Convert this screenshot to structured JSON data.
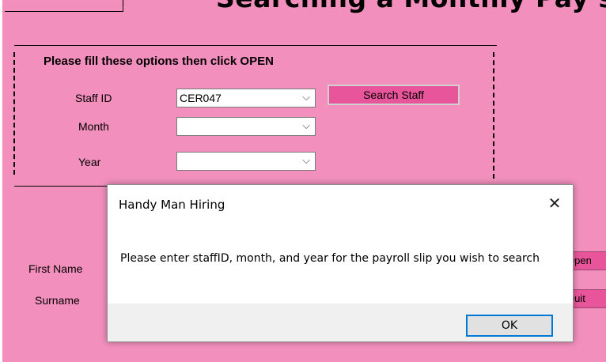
{
  "form": {
    "title": "Searching a Monthly Pay slip",
    "group_title": "Please fill these options then click OPEN",
    "staff_id_label": "Staff ID",
    "staff_id_value": "CER047",
    "month_label": "Month",
    "month_value": "",
    "year_label": "Year",
    "year_value": "",
    "search_staff_label": "Search Staff",
    "first_name_label": "First Name",
    "surname_label": "Surname",
    "open_label": "Open",
    "quit_label": "Quit"
  },
  "dialog": {
    "title": "Handy Man Hiring",
    "message": "Please enter staffID, month, and year for the payroll slip you wish to search",
    "ok_label": "OK",
    "close_glyph": "✕"
  },
  "icons": {
    "chevron": "⌵"
  },
  "colors": {
    "background": "#f28fbd",
    "button_pink": "#e9559b",
    "dialog_footer": "#f0f0f0",
    "ok_border": "#0078d7"
  }
}
